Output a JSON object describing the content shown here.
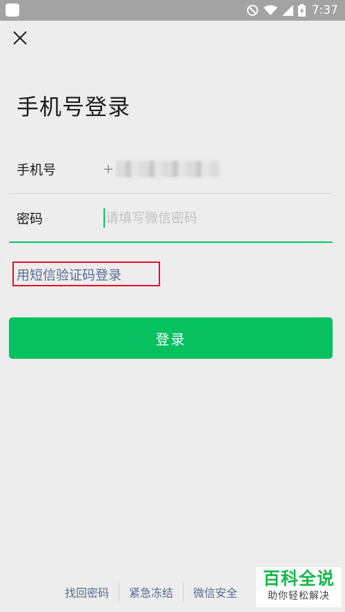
{
  "status_bar": {
    "time": "7:37",
    "icons": [
      "app-icon",
      "do-not-disturb-icon",
      "wifi-icon",
      "signal-icon",
      "battery-charging-icon"
    ]
  },
  "header": {
    "close_icon": "close-icon"
  },
  "page": {
    "title": "手机号登录"
  },
  "form": {
    "phone_label": "手机号",
    "phone_prefix": "+",
    "password_label": "密码",
    "password_placeholder": "请填写微信密码",
    "password_value": ""
  },
  "sms_login_label": "用短信验证码登录",
  "login_button_label": "登录",
  "footer": {
    "links": [
      "找回密码",
      "紧急冻结",
      "微信安全"
    ]
  },
  "watermark": {
    "title": "百科全说",
    "subtitle": "助你轻松解决"
  },
  "colors": {
    "accent": "#07c160",
    "link": "#576b95",
    "highlight_box": "#e0102a",
    "status_bar": "#a3a3a3",
    "background": "#ededed"
  }
}
